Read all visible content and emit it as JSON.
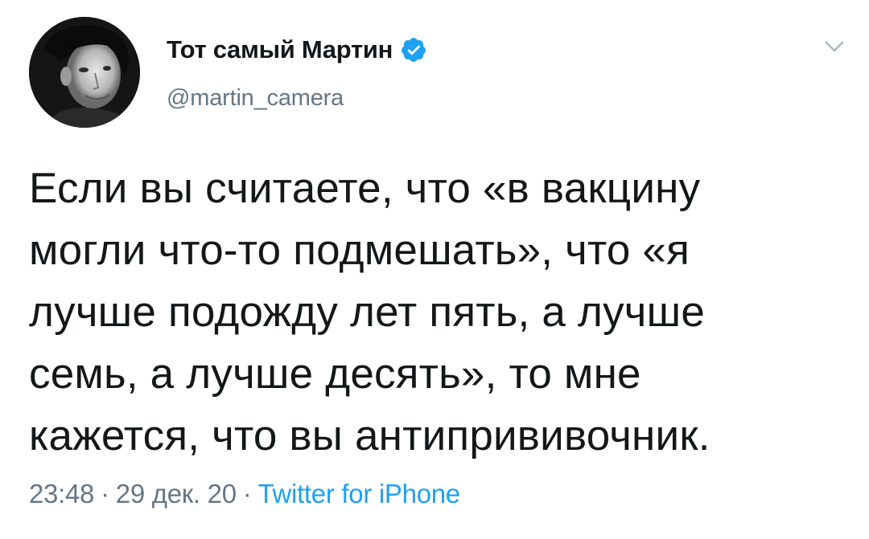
{
  "author": {
    "display_name": "Тот самый Мартин",
    "handle": "@martin_camera",
    "verified": true,
    "avatar_icon": "profile-photo"
  },
  "tweet": {
    "text_lines": [
      "Если вы считаете, что «в вакцину",
      "могли что-то подмешать», что «я",
      "лучше подожду лет пять, а лучше",
      "семь, а лучше десять», то мне",
      "кажется, что вы антипрививочник."
    ],
    "time": "23:48",
    "date": "29 дек. 20",
    "source": "Twitter for iPhone",
    "separator": "·"
  },
  "icons": {
    "verified": "verified-badge-icon",
    "menu": "chevron-down-icon"
  },
  "colors": {
    "primary_text": "#14171a",
    "secondary_text": "#657786",
    "link": "#1da1f2",
    "verified": "#1da1f2",
    "chevron": "#aab8c2",
    "background": "#ffffff"
  }
}
